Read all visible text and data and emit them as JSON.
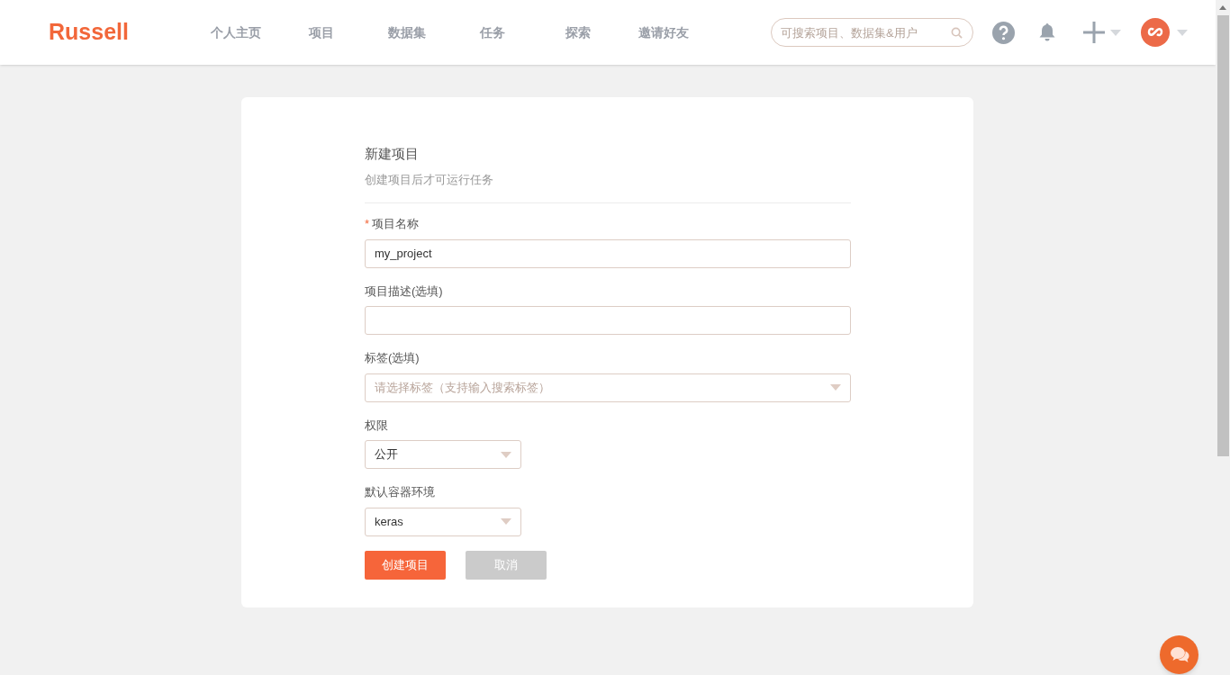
{
  "header": {
    "logo": "Russell",
    "nav": [
      {
        "label": "个人主页"
      },
      {
        "label": "项目"
      },
      {
        "label": "数据集"
      },
      {
        "label": "任务"
      },
      {
        "label": "探索"
      },
      {
        "label": "邀请好友"
      }
    ],
    "search": {
      "placeholder": "可搜索项目、数据集&用户"
    }
  },
  "form": {
    "title": "新建项目",
    "subtitle": "创建项目后才可运行任务",
    "fields": [
      {
        "kind": "text",
        "label": "项目名称",
        "required_mark": "*",
        "value": "my_project",
        "wide": true
      },
      {
        "kind": "text",
        "label": "项目描述(选填)",
        "wide": true
      },
      {
        "kind": "select",
        "label": "标签(选填)",
        "placeholder": "请选择标签（支持输入搜索标签）",
        "wide": true
      },
      {
        "kind": "select",
        "label": "权限",
        "value": "公开",
        "wide": false
      },
      {
        "kind": "select",
        "label": "默认容器环境",
        "value": "keras",
        "wide": false
      }
    ],
    "buttons": [
      {
        "label": "创建项目",
        "kind": "primary"
      },
      {
        "label": "取消",
        "kind": "secondary"
      }
    ]
  }
}
